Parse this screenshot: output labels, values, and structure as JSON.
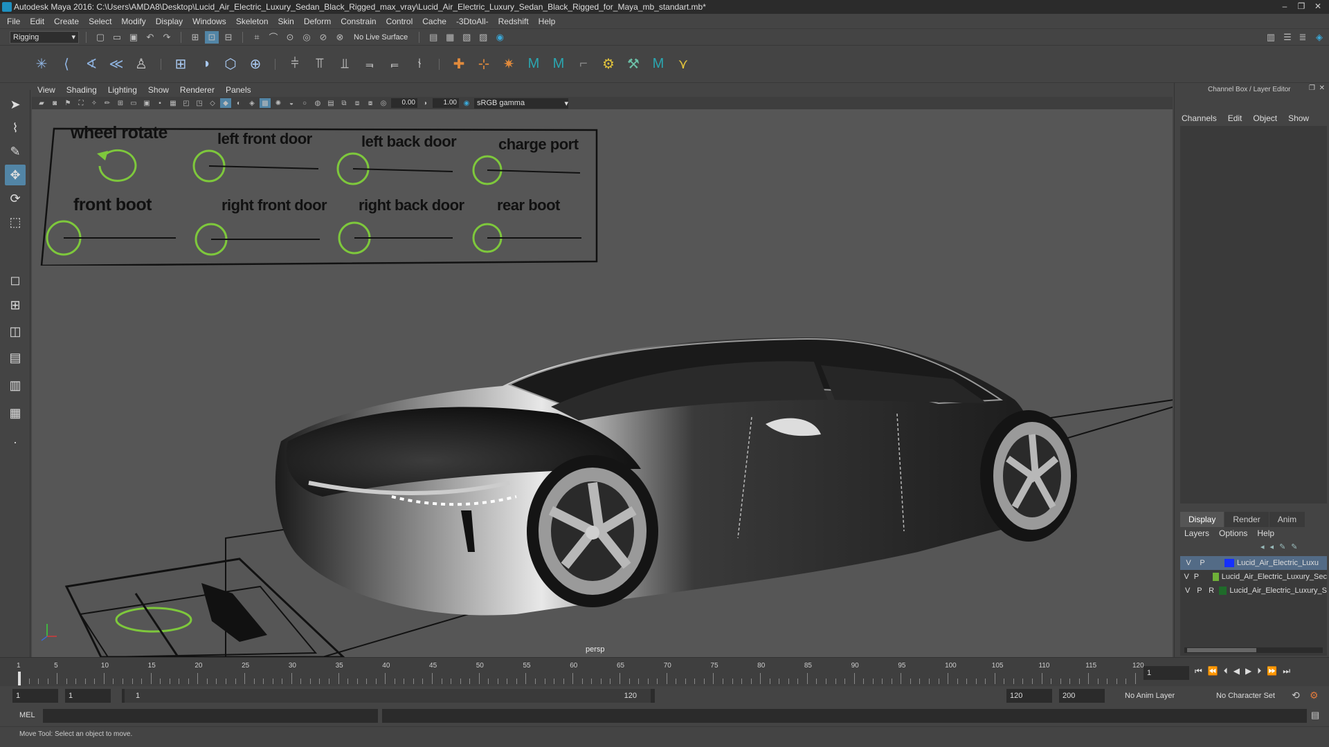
{
  "window": {
    "title": "Autodesk Maya 2016: C:\\Users\\AMDA8\\Desktop\\Lucid_Air_Electric_Luxury_Sedan_Black_Rigged_max_vray\\Lucid_Air_Electric_Luxury_Sedan_Black_Rigged_for_Maya_mb_standart.mb*",
    "controls": [
      "–",
      "❐",
      "✕"
    ]
  },
  "menu": [
    "File",
    "Edit",
    "Create",
    "Select",
    "Modify",
    "Display",
    "Windows",
    "Skeleton",
    "Skin",
    "Deform",
    "Constrain",
    "Control",
    "Cache",
    "-3DtoAll-",
    "Redshift",
    "Help"
  ],
  "status": {
    "mode": "Rigging",
    "live_surface": "No Live Surface"
  },
  "panel": {
    "menu": [
      "View",
      "Shading",
      "Lighting",
      "Show",
      "Renderer",
      "Panels"
    ],
    "exposure": "0.00",
    "gamma": "1.00",
    "color_space": "sRGB gamma",
    "camera": "persp"
  },
  "controls_panel": {
    "labels": {
      "wheel_rotate": "wheel rotate",
      "left_front_door": "left front door",
      "left_back_door": "left back door",
      "charge_port": "charge port",
      "front_boot": "front boot",
      "right_front_door": "right front door",
      "right_back_door": "right back door",
      "rear_boot": "rear boot"
    },
    "colors": {
      "control_curve": "#7ec83c",
      "text": "#111111"
    }
  },
  "channel_box": {
    "title": "Channel Box / Layer Editor",
    "menu": [
      "Channels",
      "Edit",
      "Object",
      "Show"
    ],
    "layer_tabs": [
      "Display",
      "Render",
      "Anim"
    ],
    "layer_menu": [
      "Layers",
      "Options",
      "Help"
    ],
    "layers": [
      {
        "v": "V",
        "p": "P",
        "r": "",
        "color": "#1530ff",
        "name": "Lucid_Air_Electric_Luxu"
      },
      {
        "v": "V",
        "p": "P",
        "r": "",
        "color": "#6fb038",
        "name": "Lucid_Air_Electric_Luxury_Sec"
      },
      {
        "v": "V",
        "p": "P",
        "r": "R",
        "color": "#1f6b2a",
        "name": "Lucid_Air_Electric_Luxury_S"
      }
    ]
  },
  "timeline": {
    "ticks": [
      1,
      5,
      10,
      15,
      20,
      25,
      30,
      35,
      40,
      45,
      50,
      55,
      60,
      65,
      70,
      75,
      80,
      85,
      90,
      95,
      100,
      105,
      110,
      115,
      120
    ],
    "current_frame": "1"
  },
  "range": {
    "start": "1",
    "playback_start": "1",
    "slider_start": "1",
    "slider_end": "120",
    "playback_end": "120",
    "end": "200",
    "anim_layer": "No Anim Layer",
    "character_set": "No Character Set"
  },
  "command": {
    "lang": "MEL"
  },
  "help": {
    "text": "Move Tool: Select an object to move."
  }
}
